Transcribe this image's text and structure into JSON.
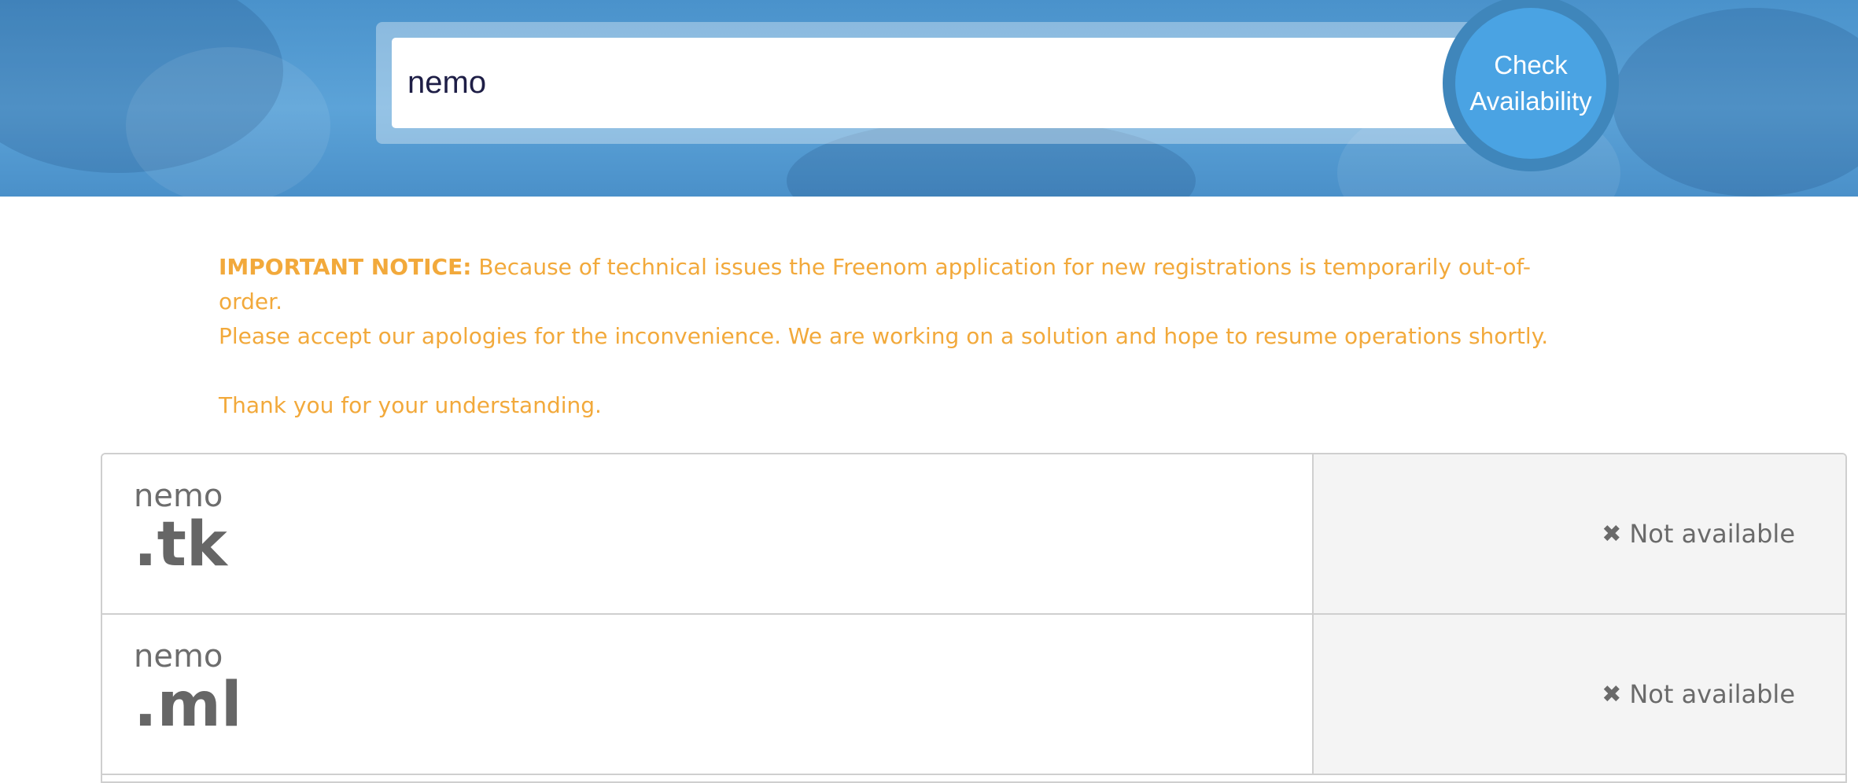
{
  "search": {
    "value": "nemo",
    "button_label": "Check Availability"
  },
  "notice": {
    "label": "IMPORTANT NOTICE:",
    "line1": "Because of technical issues the Freenom application for new registrations is temporarily out-of-order.",
    "line2": "Please accept our apologies for the inconvenience. We are working on a solution and hope to resume operations shortly.",
    "line3": "Thank you for your understanding.",
    "color": "#f2a93b"
  },
  "results": [
    {
      "name": "nemo",
      "tld": ".tk",
      "status": "Not available",
      "status_icon": "close-icon"
    },
    {
      "name": "nemo",
      "tld": ".ml",
      "status": "Not available",
      "status_icon": "close-icon"
    }
  ],
  "colors": {
    "hero": "#4a92cb",
    "button": "#4aa3e3",
    "button_ring": "#3f86bb",
    "status_bg": "#f4f4f4"
  }
}
